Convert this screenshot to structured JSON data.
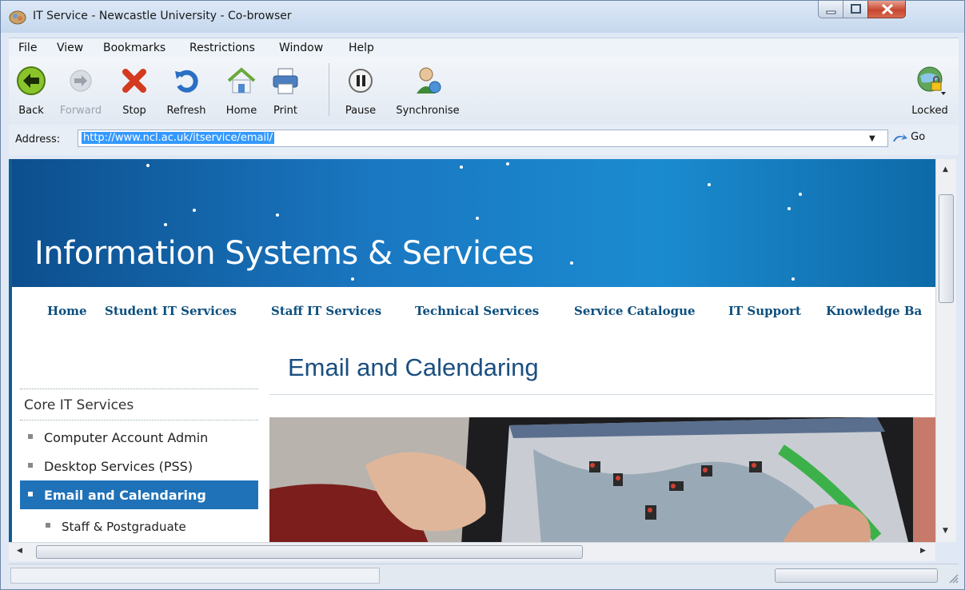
{
  "window": {
    "title": "IT Service - Newcastle University - Co-browser"
  },
  "menu": [
    {
      "label": "File"
    },
    {
      "label": "View"
    },
    {
      "label": "Bookmarks"
    },
    {
      "label": "Restrictions"
    },
    {
      "label": "Window"
    },
    {
      "label": "Help"
    }
  ],
  "toolbar": {
    "back": "Back",
    "forward": "Forward",
    "stop": "Stop",
    "refresh": "Refresh",
    "home": "Home",
    "print": "Print",
    "pause": "Pause",
    "synchronise": "Synchronise",
    "locked": "Locked"
  },
  "address": {
    "label": "Address:",
    "url": "http://www.ncl.ac.uk/itservice/email/",
    "go": "Go"
  },
  "page": {
    "banner_title": "Information Systems & Services",
    "nav": [
      {
        "label": "Home"
      },
      {
        "label": "Student IT Services"
      },
      {
        "label": "Staff IT Services"
      },
      {
        "label": "Technical Services"
      },
      {
        "label": "Service Catalogue"
      },
      {
        "label": "IT Support"
      },
      {
        "label": "Knowledge Ba"
      }
    ],
    "heading": "Email and Calendaring",
    "sidebar": {
      "title": "Core IT Services",
      "items": [
        {
          "label": "Computer Account Admin"
        },
        {
          "label": "Desktop Services (PSS)"
        },
        {
          "label": "Email and Calendaring"
        }
      ],
      "sub_item": "Staff & Postgraduate"
    }
  },
  "colors": {
    "banner": "#1a78c2",
    "nav_text": "#0d4f7e",
    "active_item": "#1f72b8",
    "heading": "#1a4f80"
  }
}
